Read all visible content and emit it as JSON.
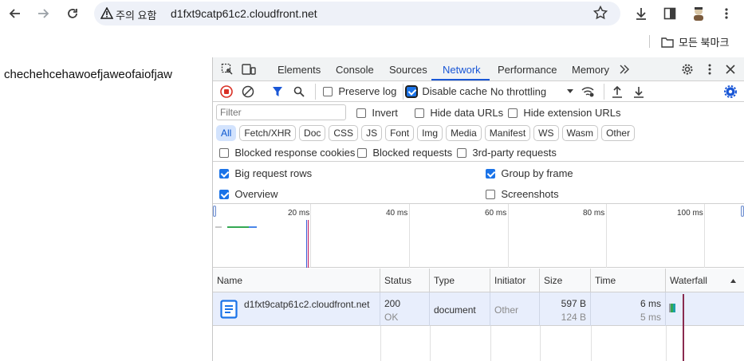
{
  "browser": {
    "security_label": "주의 요함",
    "url": "d1fxt9catp61c2.cloudfront.net",
    "bookmark_folder": "모든 북마크"
  },
  "page": {
    "text": "chechehcehawoefjaweofaiofjaw"
  },
  "devtools": {
    "tabs": [
      "Elements",
      "Console",
      "Sources",
      "Network",
      "Performance",
      "Memory"
    ],
    "active_tab": "Network",
    "toolbar": {
      "preserve_log": "Preserve log",
      "disable_cache": "Disable cache",
      "throttling": "No throttling"
    },
    "filter": {
      "placeholder": "Filter",
      "invert": "Invert",
      "hide_data_urls": "Hide data URLs",
      "hide_extension_urls": "Hide extension URLs"
    },
    "type_chips": [
      "All",
      "Fetch/XHR",
      "Doc",
      "CSS",
      "JS",
      "Font",
      "Img",
      "Media",
      "Manifest",
      "WS",
      "Wasm",
      "Other"
    ],
    "options": {
      "blocked_response_cookies": "Blocked response cookies",
      "blocked_requests": "Blocked requests",
      "third_party_requests": "3rd-party requests",
      "big_request_rows": "Big request rows",
      "group_by_frame": "Group by frame",
      "overview": "Overview",
      "screenshots": "Screenshots"
    },
    "overview_ticks": [
      "20 ms",
      "40 ms",
      "60 ms",
      "80 ms",
      "100 ms"
    ],
    "table": {
      "headers": [
        "Name",
        "Status",
        "Type",
        "Initiator",
        "Size",
        "Time",
        "Waterfall"
      ],
      "rows": [
        {
          "name": "d1fxt9catp61c2.cloudfront.net",
          "status": "200",
          "status_text": "OK",
          "type": "document",
          "initiator": "Other",
          "size": "597 B",
          "size_resource": "124 B",
          "time": "6 ms",
          "time_latency": "5 ms"
        }
      ]
    }
  },
  "colors": {
    "accent": "#1a57d6",
    "record_red": "#d93025",
    "row_selected": "#e8eefc"
  }
}
